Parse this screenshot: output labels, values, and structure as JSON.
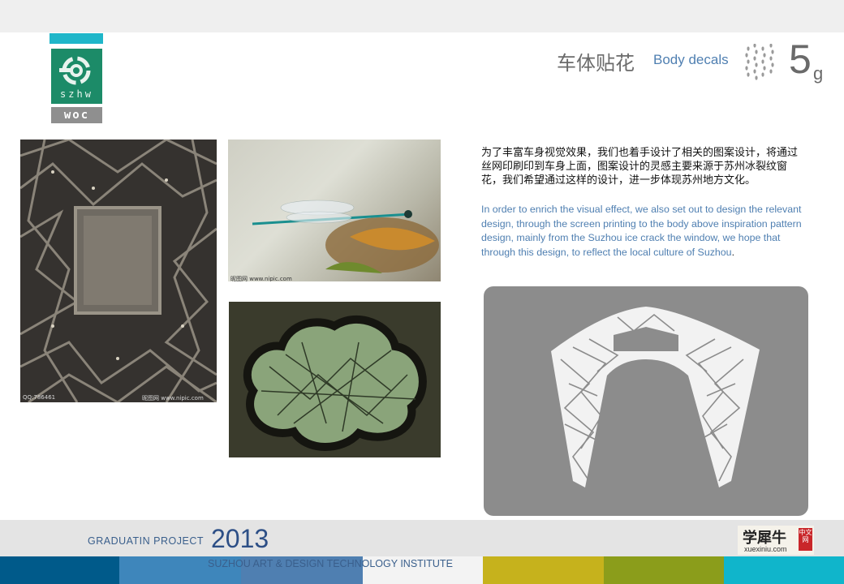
{
  "header": {
    "title_cn": "车体贴花",
    "title_en": "Body decals",
    "page_number": "5",
    "page_suffix": "g"
  },
  "logo": {
    "line1": "szhw",
    "line2": "woc"
  },
  "photos": {
    "lattice_watermark_left": "QQ:786461",
    "lattice_watermark_right": "昵图网 www.nipic.com",
    "dragonfly_watermark": "昵图网 www.nipic.com"
  },
  "description": {
    "cn": "为了丰富车身视觉效果，我们也着手设计了相关的图案设计，将通过丝网印刷印到车身上面，图案设计的灵感主要来源于苏州冰裂纹窗花，我们希望通过这样的设计，进一步体现苏州地方文化。",
    "en": " In order to enrich the visual effect, we also set out to design the relevant design, through the screen printing to the body above inspiration pattern design, mainly from the Suzhou ice crack the window, we hope that through this design, to reflect the local culture of Suzhou",
    "en_end": "."
  },
  "footer": {
    "project_label": "GRADUATIN  PROJECT",
    "year": "2013",
    "institute": "SUZHOU ART & DESIGN TECHNOLOGY INSTITUTE",
    "brand_cn": "学犀牛",
    "brand_en": "xuexiniu.com",
    "brand_stamp": "中文网"
  },
  "colors": {
    "accent_teal": "#1fb6c9",
    "logo_green": "#1c8b68",
    "title_blue": "#4f7fb1",
    "footer_navy": "#2d4f86",
    "strip": [
      "#005a8a",
      "#3e86bb",
      "#4f7fb1",
      "#f3f3f3",
      "#c6b21c",
      "#8b9d1b",
      "#10b5cb"
    ]
  }
}
